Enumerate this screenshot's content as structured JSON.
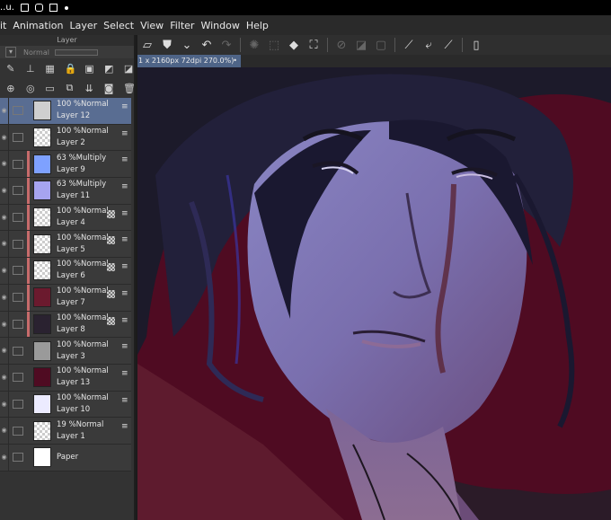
{
  "status": {
    "text": "..u."
  },
  "menu": [
    "it",
    "Animation",
    "Layer",
    "Select",
    "View",
    "Filter",
    "Window",
    "Help"
  ],
  "panel": {
    "title": "Layer",
    "blend_mode": "Normal"
  },
  "tab": {
    "title": "1 x 2160px 72dpi 270.0%)",
    "close": "•"
  },
  "layers": [
    {
      "opacity": "100 %",
      "mode": "Normal",
      "name": "Layer 12",
      "selected": true,
      "clip": false,
      "mask": false,
      "thumb": "#cfcfcf"
    },
    {
      "opacity": "100 %",
      "mode": "Normal",
      "name": "Layer 2",
      "selected": false,
      "clip": false,
      "mask": false,
      "thumb": "checker"
    },
    {
      "opacity": "63 %",
      "mode": "Multiply",
      "name": "Layer 9",
      "selected": false,
      "clip": true,
      "mask": false,
      "thumb": "#7ea1ff"
    },
    {
      "opacity": "63 %",
      "mode": "Multiply",
      "name": "Layer 11",
      "selected": false,
      "clip": true,
      "mask": false,
      "thumb": "#a6a4f0"
    },
    {
      "opacity": "100 %",
      "mode": "Normal",
      "name": "Layer 4",
      "selected": false,
      "clip": true,
      "mask": true,
      "thumb": "checker"
    },
    {
      "opacity": "100 %",
      "mode": "Normal",
      "name": "Layer 5",
      "selected": false,
      "clip": true,
      "mask": true,
      "thumb": "checker"
    },
    {
      "opacity": "100 %",
      "mode": "Normal",
      "name": "Layer 6",
      "selected": false,
      "clip": true,
      "mask": true,
      "thumb": "checker"
    },
    {
      "opacity": "100 %",
      "mode": "Normal",
      "name": "Layer 7",
      "selected": false,
      "clip": true,
      "mask": true,
      "thumb": "#6b1a2e"
    },
    {
      "opacity": "100 %",
      "mode": "Normal",
      "name": "Layer 8",
      "selected": false,
      "clip": true,
      "mask": true,
      "thumb": "#2a2230"
    },
    {
      "opacity": "100 %",
      "mode": "Normal",
      "name": "Layer 3",
      "selected": false,
      "clip": false,
      "mask": false,
      "thumb": "#9a9a9a"
    },
    {
      "opacity": "100 %",
      "mode": "Normal",
      "name": "Layer 13",
      "selected": false,
      "clip": false,
      "mask": false,
      "thumb": "#4f0b22"
    },
    {
      "opacity": "100 %",
      "mode": "Normal",
      "name": "Layer 10",
      "selected": false,
      "clip": false,
      "mask": false,
      "thumb": "#ecebff"
    },
    {
      "opacity": "19 %",
      "mode": "Normal",
      "name": "Layer 1",
      "selected": false,
      "clip": false,
      "mask": false,
      "thumb": "checker"
    },
    {
      "opacity": "",
      "mode": "",
      "name": "Paper",
      "selected": false,
      "clip": false,
      "mask": false,
      "thumb": "#ffffff"
    }
  ],
  "toolbar_icons": [
    "open-icon",
    "save-icon",
    "chevron-down-icon",
    "undo-icon",
    "redo-icon",
    "loading-icon",
    "transform-icon",
    "fill-icon",
    "crop-icon",
    "clear-icon",
    "fill-layer-icon",
    "deselect-icon",
    "line-icon",
    "curve-icon",
    "ruler-icon",
    "device-icon"
  ]
}
